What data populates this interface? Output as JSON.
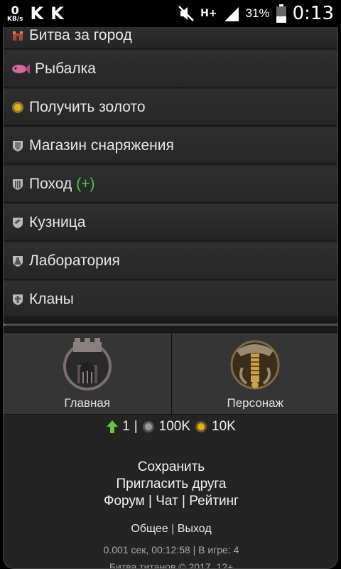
{
  "status_bar": {
    "network_speed": "0",
    "network_unit": "KB/s",
    "app_icon_1": "K",
    "app_icon_2": "K",
    "network_type": "H+",
    "battery_percent": "31%",
    "time": "0:13"
  },
  "menu": {
    "items": [
      {
        "label": "Битва за город",
        "icon": "castle-icon"
      },
      {
        "label": "Рыбалка",
        "icon": "fish-icon"
      },
      {
        "label": "Получить золото",
        "icon": "gold-coin-icon"
      },
      {
        "label": "Магазин снаряжения",
        "icon": "shield-icon"
      },
      {
        "label": "Поход",
        "extra": "(+)",
        "icon": "gate-icon"
      },
      {
        "label": "Кузница",
        "icon": "anvil-icon"
      },
      {
        "label": "Лаборатория",
        "icon": "flask-icon"
      },
      {
        "label": "Кланы",
        "icon": "clan-icon"
      }
    ]
  },
  "tiles": [
    {
      "label": "Главная",
      "icon": "tower-icon"
    },
    {
      "label": "Персонаж",
      "icon": "character-icon"
    }
  ],
  "stats": {
    "level": "1",
    "silver": "100K",
    "gold": "10K",
    "sep": "|"
  },
  "links": {
    "save": "Сохранить",
    "invite": "Пригласить друга",
    "forum": "Форум",
    "chat": "Чат",
    "rating": "Рейтинг",
    "sep": "|"
  },
  "nav": {
    "general": "Общее",
    "exit": "Выход",
    "sep": "|"
  },
  "meta": {
    "timing": "0.001 сек, 00:12:58 | В игре: 4",
    "copyright": "Битва титанов © 2017, 12+"
  }
}
